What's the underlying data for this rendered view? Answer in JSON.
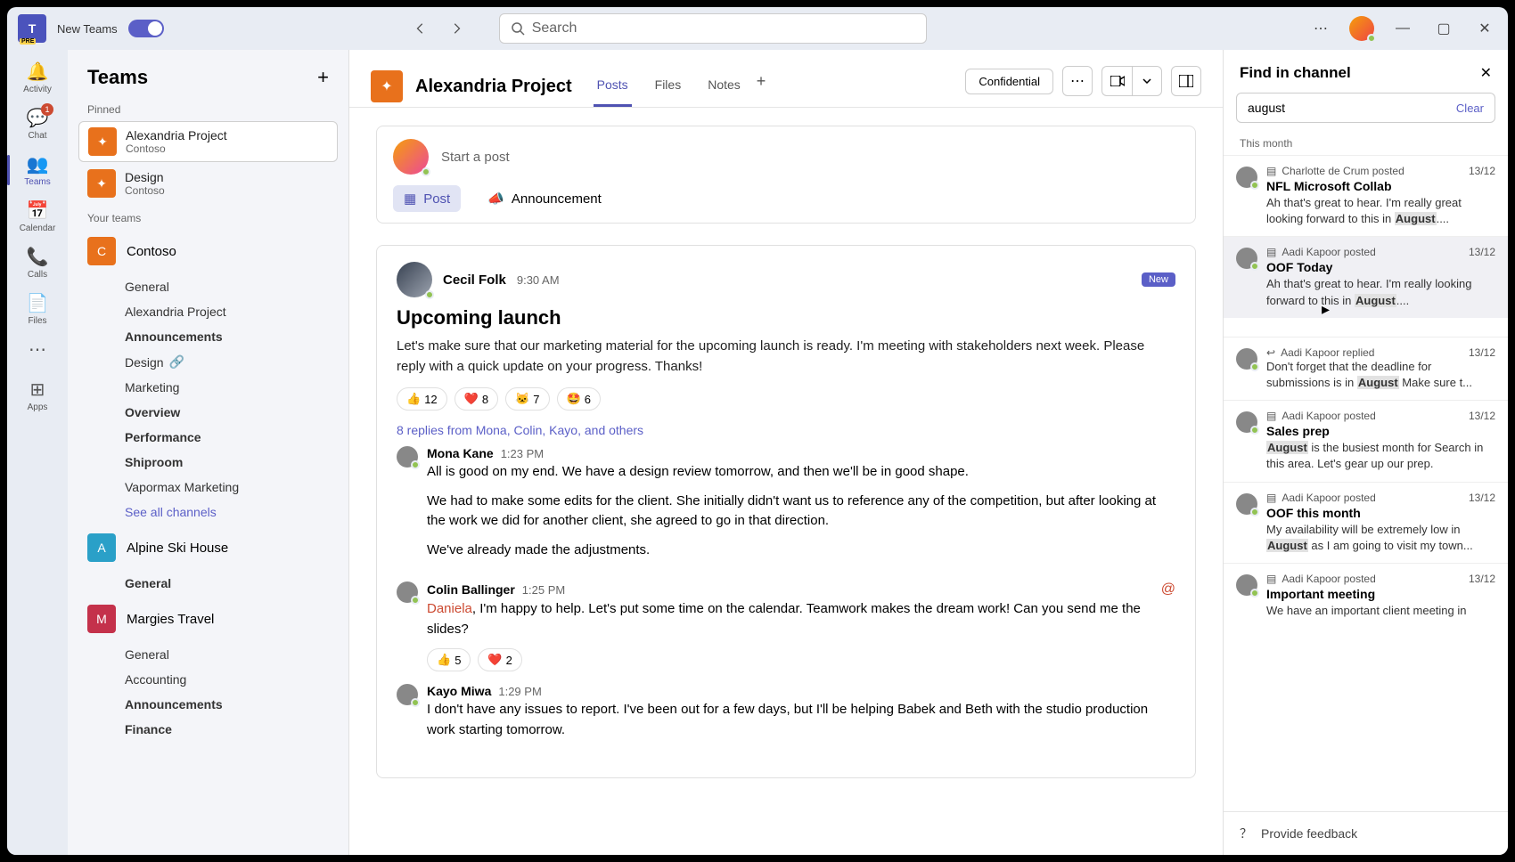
{
  "titlebar": {
    "title": "New Teams",
    "search_placeholder": "Search"
  },
  "rail": {
    "activity": "Activity",
    "chat": "Chat",
    "teams": "Teams",
    "calendar": "Calendar",
    "calls": "Calls",
    "files": "Files",
    "apps": "Apps",
    "chat_badge": "1"
  },
  "sidebar": {
    "title": "Teams",
    "pinned_label": "Pinned",
    "yourteams_label": "Your teams",
    "pinned": [
      {
        "name": "Alexandria Project",
        "sub": "Contoso",
        "color": "#e8711c"
      },
      {
        "name": "Design",
        "sub": "Contoso",
        "color": "#e8711c"
      }
    ],
    "teams": [
      {
        "name": "Contoso",
        "color": "#e8711c",
        "channels": [
          {
            "name": "General",
            "bold": false
          },
          {
            "name": "Alexandria Project",
            "bold": false
          },
          {
            "name": "Announcements",
            "bold": true
          },
          {
            "name": "Design",
            "bold": false,
            "icon": "link"
          },
          {
            "name": "Marketing",
            "bold": false
          },
          {
            "name": "Overview",
            "bold": true
          },
          {
            "name": "Performance",
            "bold": true
          },
          {
            "name": "Shiproom",
            "bold": true
          },
          {
            "name": "Vapormax Marketing",
            "bold": false
          }
        ],
        "see_all": "See all channels"
      },
      {
        "name": "Alpine Ski House",
        "color": "#2aa0c8",
        "channels": [
          {
            "name": "General",
            "bold": true
          }
        ]
      },
      {
        "name": "Margies Travel",
        "color": "#c4314b",
        "channels": [
          {
            "name": "General",
            "bold": false
          },
          {
            "name": "Accounting",
            "bold": false
          },
          {
            "name": "Announcements",
            "bold": true
          },
          {
            "name": "Finance",
            "bold": true
          }
        ]
      }
    ]
  },
  "channel": {
    "name": "Alexandria Project",
    "tabs": [
      "Posts",
      "Files",
      "Notes"
    ],
    "confidential": "Confidential"
  },
  "compose": {
    "placeholder": "Start a post",
    "post": "Post",
    "announcement": "Announcement"
  },
  "post": {
    "author": "Cecil Folk",
    "time": "9:30 AM",
    "badge": "New",
    "title": "Upcoming launch",
    "body": "Let's make sure that our marketing material for the upcoming launch is ready. I'm meeting with stakeholders next week. Please reply with a quick update on your progress. Thanks!",
    "reactions": [
      {
        "emoji": "👍",
        "count": "12"
      },
      {
        "emoji": "❤️",
        "count": "8"
      },
      {
        "emoji": "🐱",
        "count": "7"
      },
      {
        "emoji": "🤩",
        "count": "6"
      }
    ],
    "replies_link": "8 replies from Mona, Colin, Kayo, and others",
    "replies": [
      {
        "author": "Mona Kane",
        "time": "1:23 PM",
        "paragraphs": [
          "All is good on my end. We have a design review tomorrow, and then we'll be in good shape.",
          "We had to make some edits for the client. She initially didn't want us to reference any of the competition, but after looking at the work we did for another client, she agreed to go in that direction.",
          "We've already made the adjustments."
        ]
      },
      {
        "author": "Colin Ballinger",
        "time": "1:25 PM",
        "mention": "Daniela",
        "at": true,
        "text": ", I'm happy to help. Let's put some time on the calendar. Teamwork makes the dream work! Can you send me the slides?",
        "reactions": [
          {
            "emoji": "👍",
            "count": "5"
          },
          {
            "emoji": "❤️",
            "count": "2"
          }
        ]
      },
      {
        "author": "Kayo Miwa",
        "time": "1:29 PM",
        "paragraphs": [
          "I don't have any issues to report. I've been out for a few days, but I'll be helping Babek and Beth with the studio production work starting tomorrow."
        ]
      }
    ]
  },
  "find": {
    "title": "Find in channel",
    "query": "august",
    "clear": "Clear",
    "section": "This month",
    "feedback": "Provide feedback",
    "results": [
      {
        "who": "Charlotte de Crum",
        "verb": "posted",
        "date": "13/12",
        "title": "NFL Microsoft Collab",
        "before": "Ah that's great to hear. I'm really great looking forward to this in ",
        "hl": "August",
        "after": "...."
      },
      {
        "who": "Aadi Kapoor",
        "verb": "posted",
        "date": "13/12",
        "title": "OOF Today",
        "before": "Ah that's great to hear. I'm really looking forward to this in ",
        "hl": "August",
        "after": "....",
        "selected": true
      },
      {
        "who": "Aadi Kapoor",
        "verb": "replied",
        "date": "13/12",
        "title": "",
        "before": "Don't forget that the deadline for submissions is in ",
        "hl": "August",
        "after": " Make sure t...",
        "reply": true
      },
      {
        "who": "Aadi Kapoor",
        "verb": "posted",
        "date": "13/12",
        "title": "Sales prep",
        "before": "",
        "hl": "August",
        "after": " is the busiest month for Search in this area. Let's gear up our prep."
      },
      {
        "who": "Aadi Kapoor",
        "verb": "posted",
        "date": "13/12",
        "title": "OOF this month",
        "before": "My availability will be extremely low in ",
        "hl": "August",
        "after": " as I am going to visit my town..."
      },
      {
        "who": "Aadi Kapoor",
        "verb": "posted",
        "date": "13/12",
        "title": "Important meeting",
        "before": "We have an important client meeting in",
        "hl": "",
        "after": ""
      }
    ]
  }
}
